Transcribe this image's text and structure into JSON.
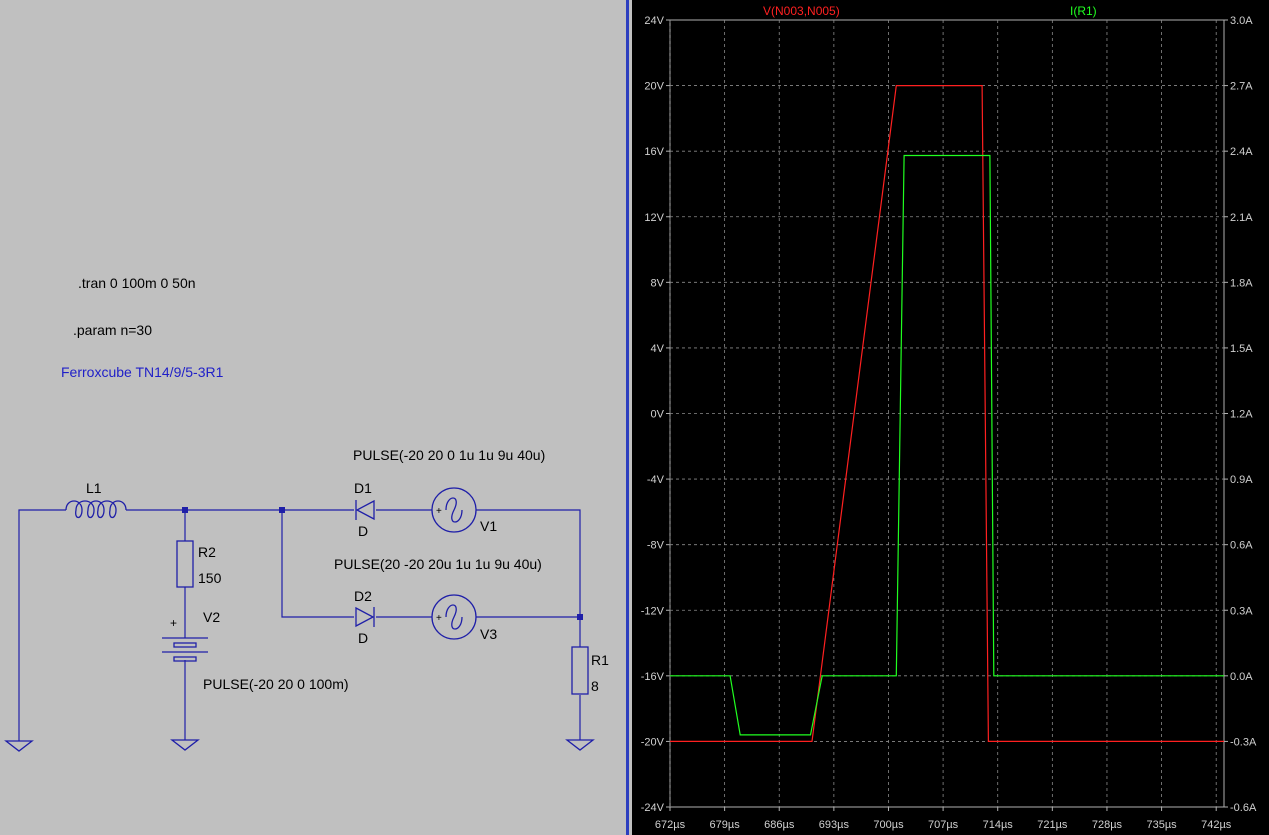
{
  "schematic": {
    "directives": {
      "tran": ".tran 0 100m 0 50n",
      "param": ".param n=30"
    },
    "comment": "Ferroxcube TN14/9/5-3R1",
    "comment_color": "#1f1fc8",
    "components": {
      "L1": {
        "name": "L1"
      },
      "R2": {
        "name": "R2",
        "value": "150"
      },
      "V2": {
        "name": "V2",
        "value": "PULSE(-20 20 0 100m)"
      },
      "D1": {
        "name": "D1",
        "model": "D"
      },
      "V1": {
        "name": "V1",
        "value": "PULSE(-20 20 0 1u 1u 9u 40u)"
      },
      "D2": {
        "name": "D2",
        "model": "D"
      },
      "V3": {
        "name": "V3",
        "value": "PULSE(20 -20 20u 1u 1u 9u 40u)"
      },
      "R1": {
        "name": "R1",
        "value": "8"
      }
    },
    "plus_sign": "+",
    "wire_color": "#1f1fa8"
  },
  "plot": {
    "traces": [
      {
        "name": "V(N003,N005)",
        "color": "#ff2020"
      },
      {
        "name": "I(R1)",
        "color": "#20ff20"
      }
    ],
    "left_axis_ticks": [
      "24V",
      "20V",
      "16V",
      "12V",
      "8V",
      "4V",
      "0V",
      "-4V",
      "-8V",
      "-12V",
      "-16V",
      "-20V",
      "-24V"
    ],
    "right_axis_ticks": [
      "3.0A",
      "2.7A",
      "2.4A",
      "2.1A",
      "1.8A",
      "1.5A",
      "1.2A",
      "0.9A",
      "0.6A",
      "0.3A",
      "0.0A",
      "-0.3A",
      "-0.6A"
    ],
    "x_axis_ticks": [
      "672µs",
      "679µs",
      "686µs",
      "693µs",
      "700µs",
      "707µs",
      "714µs",
      "721µs",
      "728µs",
      "735µs",
      "742µs"
    ],
    "grid": true
  },
  "chart_data": {
    "type": "line",
    "xlabel": "",
    "ylabel": "",
    "xlim": [
      672,
      743
    ],
    "ylim_left": [
      -24,
      24
    ],
    "ylim_right": [
      -0.6,
      3.0
    ],
    "x_unit": "µs",
    "series": [
      {
        "name": "V(N003,N005)",
        "axis": "left",
        "x": [
          672,
          690.2,
          701.0,
          712.0,
          712.8,
          745.0
        ],
        "y": [
          -20,
          -20,
          20,
          20,
          -20,
          -20
        ]
      },
      {
        "name": "I(R1)",
        "axis": "right",
        "x": [
          672,
          679.7,
          681.0,
          690.0,
          691.5,
          693.0,
          701.0,
          702.0,
          713.0,
          713.5,
          714.5,
          734.8,
          736.0,
          745.0
        ],
        "y": [
          0.0,
          0.0,
          -0.27,
          -0.27,
          0.0,
          0.0,
          0.0,
          2.38,
          2.38,
          0.0,
          0.0,
          0.0,
          0.0,
          0.0
        ]
      }
    ]
  }
}
